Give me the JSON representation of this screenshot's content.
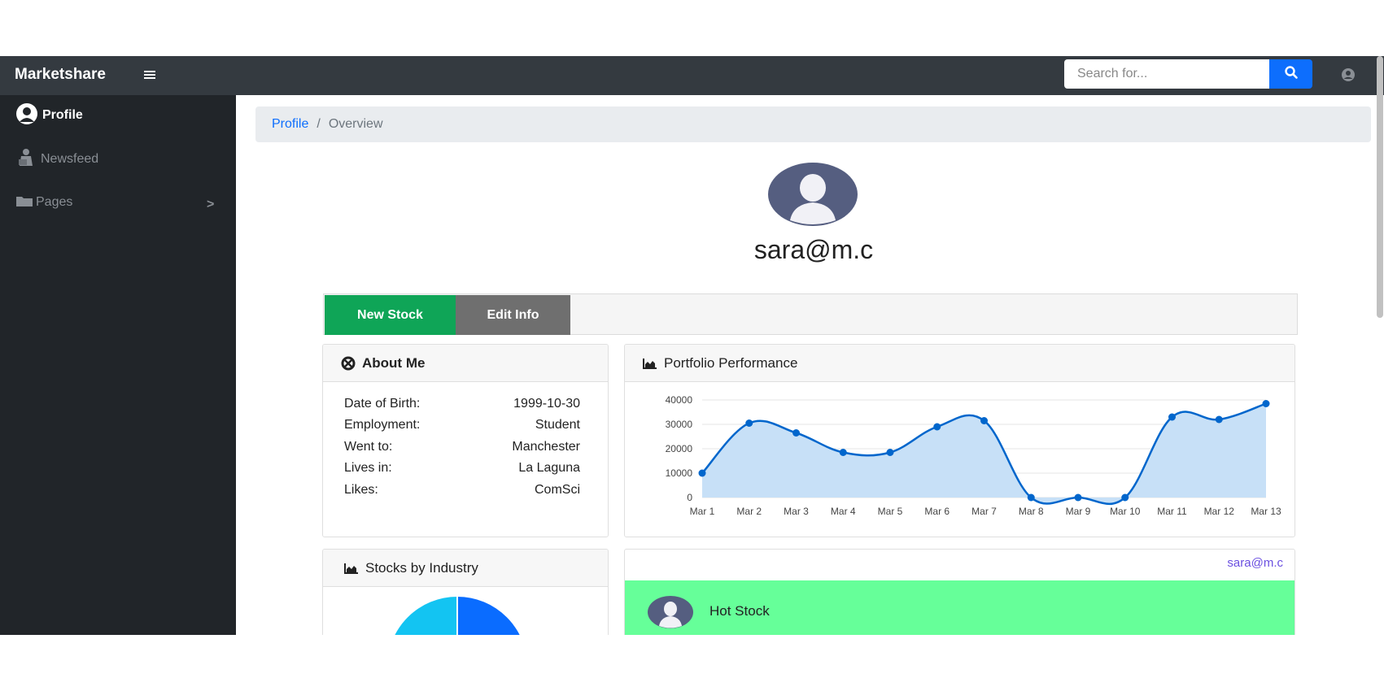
{
  "app": {
    "brand": "Marketshare"
  },
  "search": {
    "placeholder": "Search for..."
  },
  "sidebar": {
    "items": [
      {
        "label": "Profile",
        "icon": "user-circle-icon",
        "active": true
      },
      {
        "label": "Newsfeed",
        "icon": "reader-icon",
        "active": false
      },
      {
        "label": "Pages",
        "icon": "folder-icon",
        "active": false
      }
    ]
  },
  "breadcrumb": {
    "link": "Profile",
    "separator": "/",
    "current": "Overview"
  },
  "profile": {
    "username": "sara@m.c"
  },
  "actions": {
    "new_stock": "New Stock",
    "edit_info": "Edit Info"
  },
  "about": {
    "title": "About Me",
    "rows": [
      {
        "key": "Date of Birth:",
        "value": "1999-10-30"
      },
      {
        "key": "Employment:",
        "value": "Student"
      },
      {
        "key": "Went to:",
        "value": "Manchester"
      },
      {
        "key": "Lives in:",
        "value": "La Laguna"
      },
      {
        "key": "Likes:",
        "value": "ComSci"
      }
    ]
  },
  "performance": {
    "title": "Portfolio Performance"
  },
  "stocks": {
    "title": "Stocks by Industry"
  },
  "feed": {
    "email": "sara@m.c",
    "hot_label": "Hot Stock"
  },
  "colors": {
    "navbar": "#343a40",
    "sidebar": "#212529",
    "primary": "#0d6efd",
    "success": "#0fa557",
    "secondary": "#6f6f6f",
    "hot": "#66ff99",
    "line": "#0066cc",
    "area": "#c7e0f7",
    "pie_a": "#13c4f2",
    "pie_b": "#0a6cff"
  },
  "chart_data": {
    "type": "area",
    "x": [
      "Mar 1",
      "Mar 2",
      "Mar 3",
      "Mar 4",
      "Mar 5",
      "Mar 6",
      "Mar 7",
      "Mar 8",
      "Mar 9",
      "Mar 10",
      "Mar 11",
      "Mar 12",
      "Mar 13"
    ],
    "y_ticks": [
      "40000",
      "30000",
      "20000",
      "10000",
      "0"
    ],
    "values": [
      10000,
      30500,
      26500,
      18500,
      18500,
      29000,
      31500,
      0,
      0,
      0,
      33000,
      32000,
      38500
    ],
    "ylim": [
      0,
      40000
    ],
    "grid": true,
    "legend": false
  }
}
